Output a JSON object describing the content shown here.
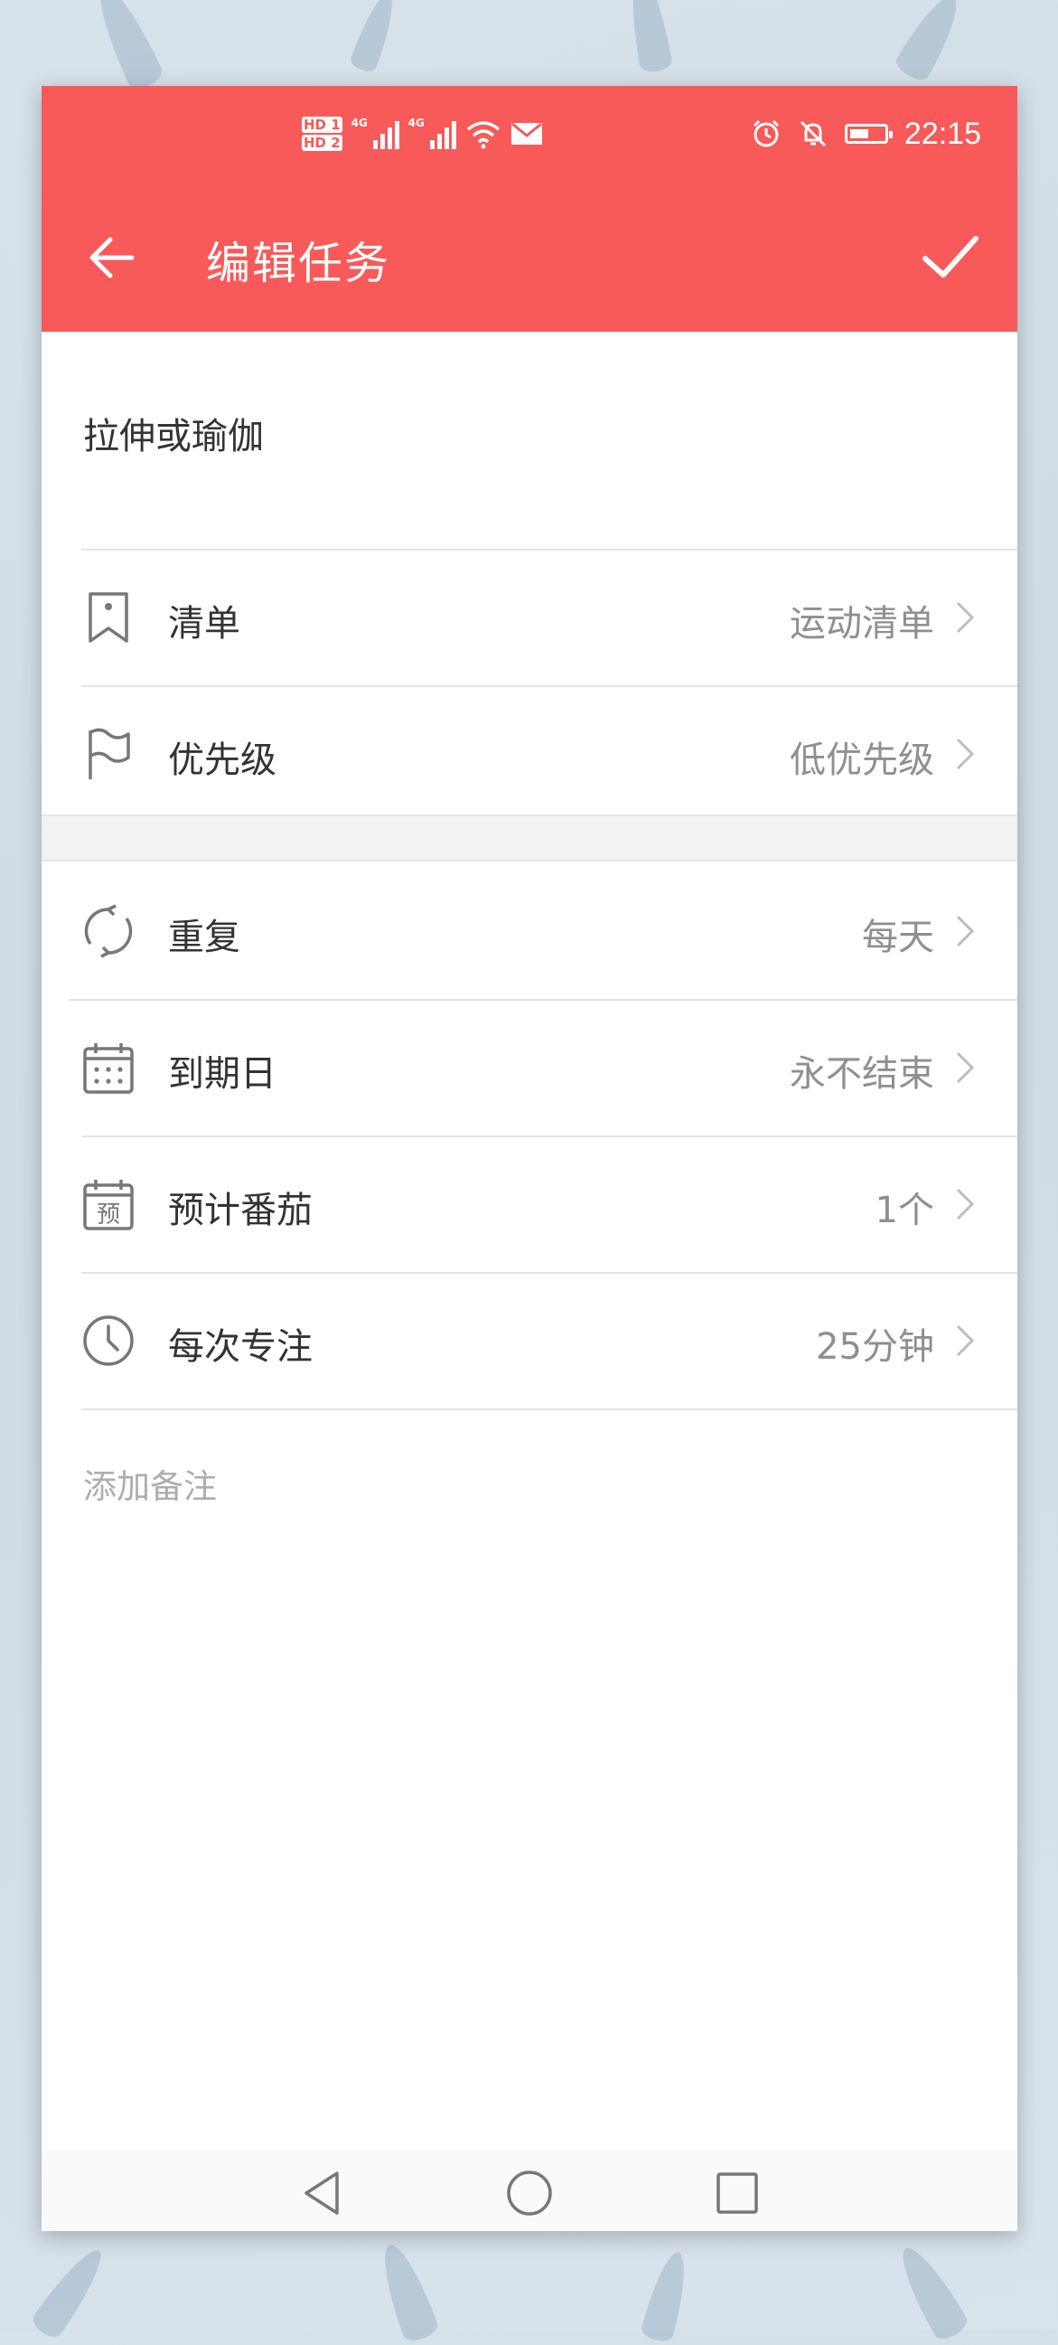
{
  "status_bar": {
    "hd1": "HD 1",
    "hd2": "HD 2",
    "net1": "4G",
    "net2": "4G",
    "time": "22:15",
    "battery_level": 0.55,
    "icons": [
      "signal-icon",
      "wifi-icon",
      "mail-icon",
      "alarm-icon",
      "silent-icon",
      "battery-icon"
    ]
  },
  "app_bar": {
    "title": "编辑任务",
    "back_icon": "back-arrow-icon",
    "confirm_icon": "check-icon",
    "color": "#f75a59"
  },
  "task": {
    "name": "拉伸或瑜伽"
  },
  "settings_group_1": [
    {
      "icon": "bookmark-icon",
      "label": "清单",
      "value": "运动清单"
    },
    {
      "icon": "flag-icon",
      "label": "优先级",
      "value": "低优先级"
    }
  ],
  "settings_group_2": [
    {
      "icon": "repeat-icon",
      "label": "重复",
      "value": "每天"
    },
    {
      "icon": "calendar-icon",
      "label": "到期日",
      "value": "永不结束"
    },
    {
      "icon": "estimate-icon",
      "label": "预计番茄",
      "value": "1个",
      "icon_text": "预"
    },
    {
      "icon": "clock-icon",
      "label": "每次专注",
      "value": "25分钟"
    }
  ],
  "note": {
    "placeholder": "添加备注"
  },
  "nav_bar": {
    "buttons": [
      "back-triangle-icon",
      "home-circle-icon",
      "recents-square-icon"
    ]
  }
}
